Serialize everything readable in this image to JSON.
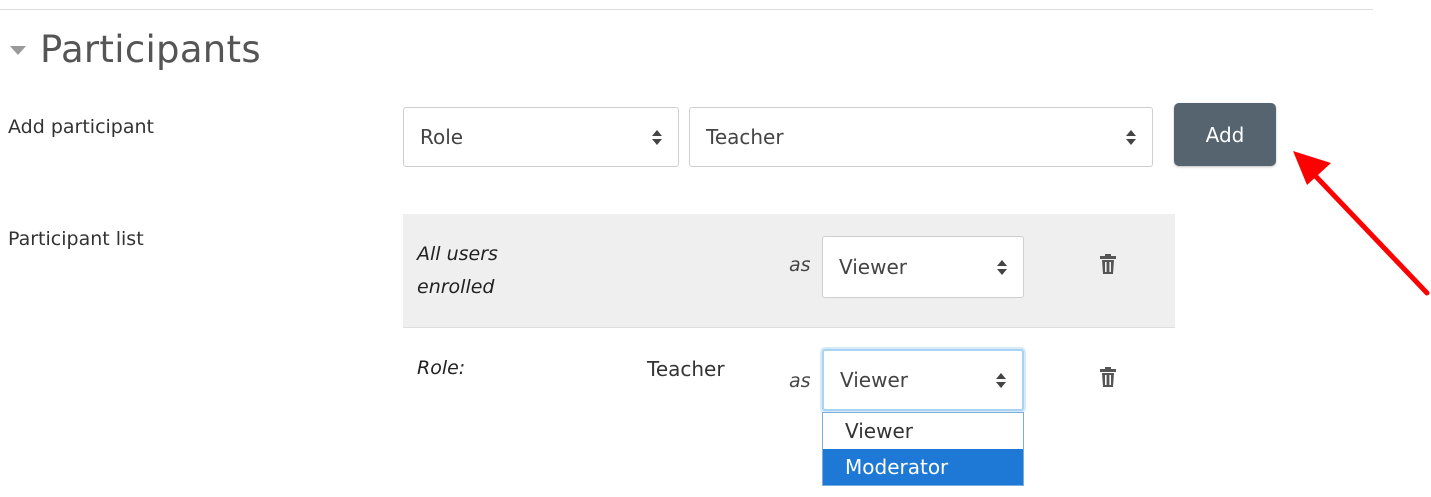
{
  "section": {
    "title": "Participants"
  },
  "add_participant": {
    "label": "Add participant",
    "type_select": {
      "value": "Role"
    },
    "value_select": {
      "value": "Teacher"
    },
    "add_button": "Add"
  },
  "participant_list": {
    "label": "Participant list",
    "rows": [
      {
        "subject_line1": "All users",
        "subject_line2": "enrolled",
        "role_value": "",
        "as": "as",
        "permission": "Viewer"
      },
      {
        "subject_line1": "Role:",
        "subject_line2": "",
        "role_value": "Teacher",
        "as": "as",
        "permission": "Viewer"
      }
    ],
    "dropdown_options": [
      {
        "label": "Viewer",
        "selected": false
      },
      {
        "label": "Moderator",
        "selected": true
      }
    ]
  },
  "colors": {
    "add_button_bg": "#55646e",
    "selected_option_bg": "#1e78d6",
    "annotation_arrow": "#ff0000"
  }
}
